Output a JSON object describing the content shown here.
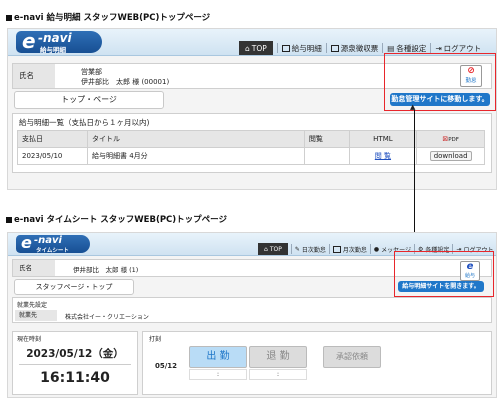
{
  "captions": {
    "payroll": "e-navi 給与明細 スタッフWEB(PC)トップページ",
    "timesheet": "e-navi タイムシート スタッフWEB(PC)トップページ"
  },
  "payroll": {
    "logo": {
      "letter": "e",
      "name": "-navi",
      "sub": "給与明細"
    },
    "nav": [
      {
        "label": "TOP",
        "icon": "home-icon",
        "active": true
      },
      {
        "label": "給与明細",
        "icon": "document-icon"
      },
      {
        "label": "源泉徴収票",
        "icon": "document-icon"
      },
      {
        "label": "各種設定",
        "icon": "settings-icon"
      },
      {
        "label": "ログアウト",
        "icon": "logout-icon"
      }
    ],
    "user": {
      "label": "氏名",
      "dept": "営業部",
      "name": "伊井部比　太郎 様 (00001)"
    },
    "attendance_link": {
      "label": "勤怠",
      "tooltip": "勤怠管理サイトに移動します。"
    },
    "top_page_button": "トップ・ページ",
    "list_title": "給与明細一覧（支払日から１ヶ月以内)",
    "table": {
      "headers": [
        "支払日",
        "タイトル",
        "閲覧",
        "HTML",
        "PDF"
      ],
      "rows": [
        {
          "date": "2023/05/10",
          "title": "給与明細書 4月分",
          "view": "",
          "html": "閲 覧",
          "pdf": "download"
        }
      ]
    }
  },
  "timesheet": {
    "logo": {
      "letter": "e",
      "name": "-navi",
      "sub": "タイムシート"
    },
    "nav": [
      {
        "label": "TOP",
        "icon": "home-icon",
        "active": true
      },
      {
        "label": "日次勤怠",
        "icon": "pencil-icon"
      },
      {
        "label": "月次勤怠",
        "icon": "document-icon"
      },
      {
        "label": "メッセージ",
        "icon": "message-icon"
      },
      {
        "label": "各種設定",
        "icon": "settings-icon"
      },
      {
        "label": "ログアウト",
        "icon": "logout-icon"
      }
    ],
    "user": {
      "label": "氏名",
      "name": "伊井部比　太郎 様 (1)"
    },
    "payroll_link": {
      "label": "給与",
      "tooltip": "給与明細サイトを開きます。"
    },
    "staff_page_button": "スタッフページ・トップ",
    "work_section": {
      "title": "就業先設定",
      "label": "就業先",
      "value": "株式会社イー・クリエーション"
    },
    "clock": {
      "title": "現在時刻",
      "date": "2023/05/12（金）",
      "time": "16:11:40"
    },
    "punch": {
      "title": "打刻",
      "date": "05/12",
      "clock_in": "出 勤",
      "clock_out": "退 勤",
      "approval": "承認依頼",
      "in_time": ":",
      "out_time": ":"
    }
  },
  "colors": {
    "accent": "#1f77c9",
    "highlight": "#e8262b",
    "header_bg": "#dbe9f5",
    "clock_in": "#b9dcf6"
  }
}
